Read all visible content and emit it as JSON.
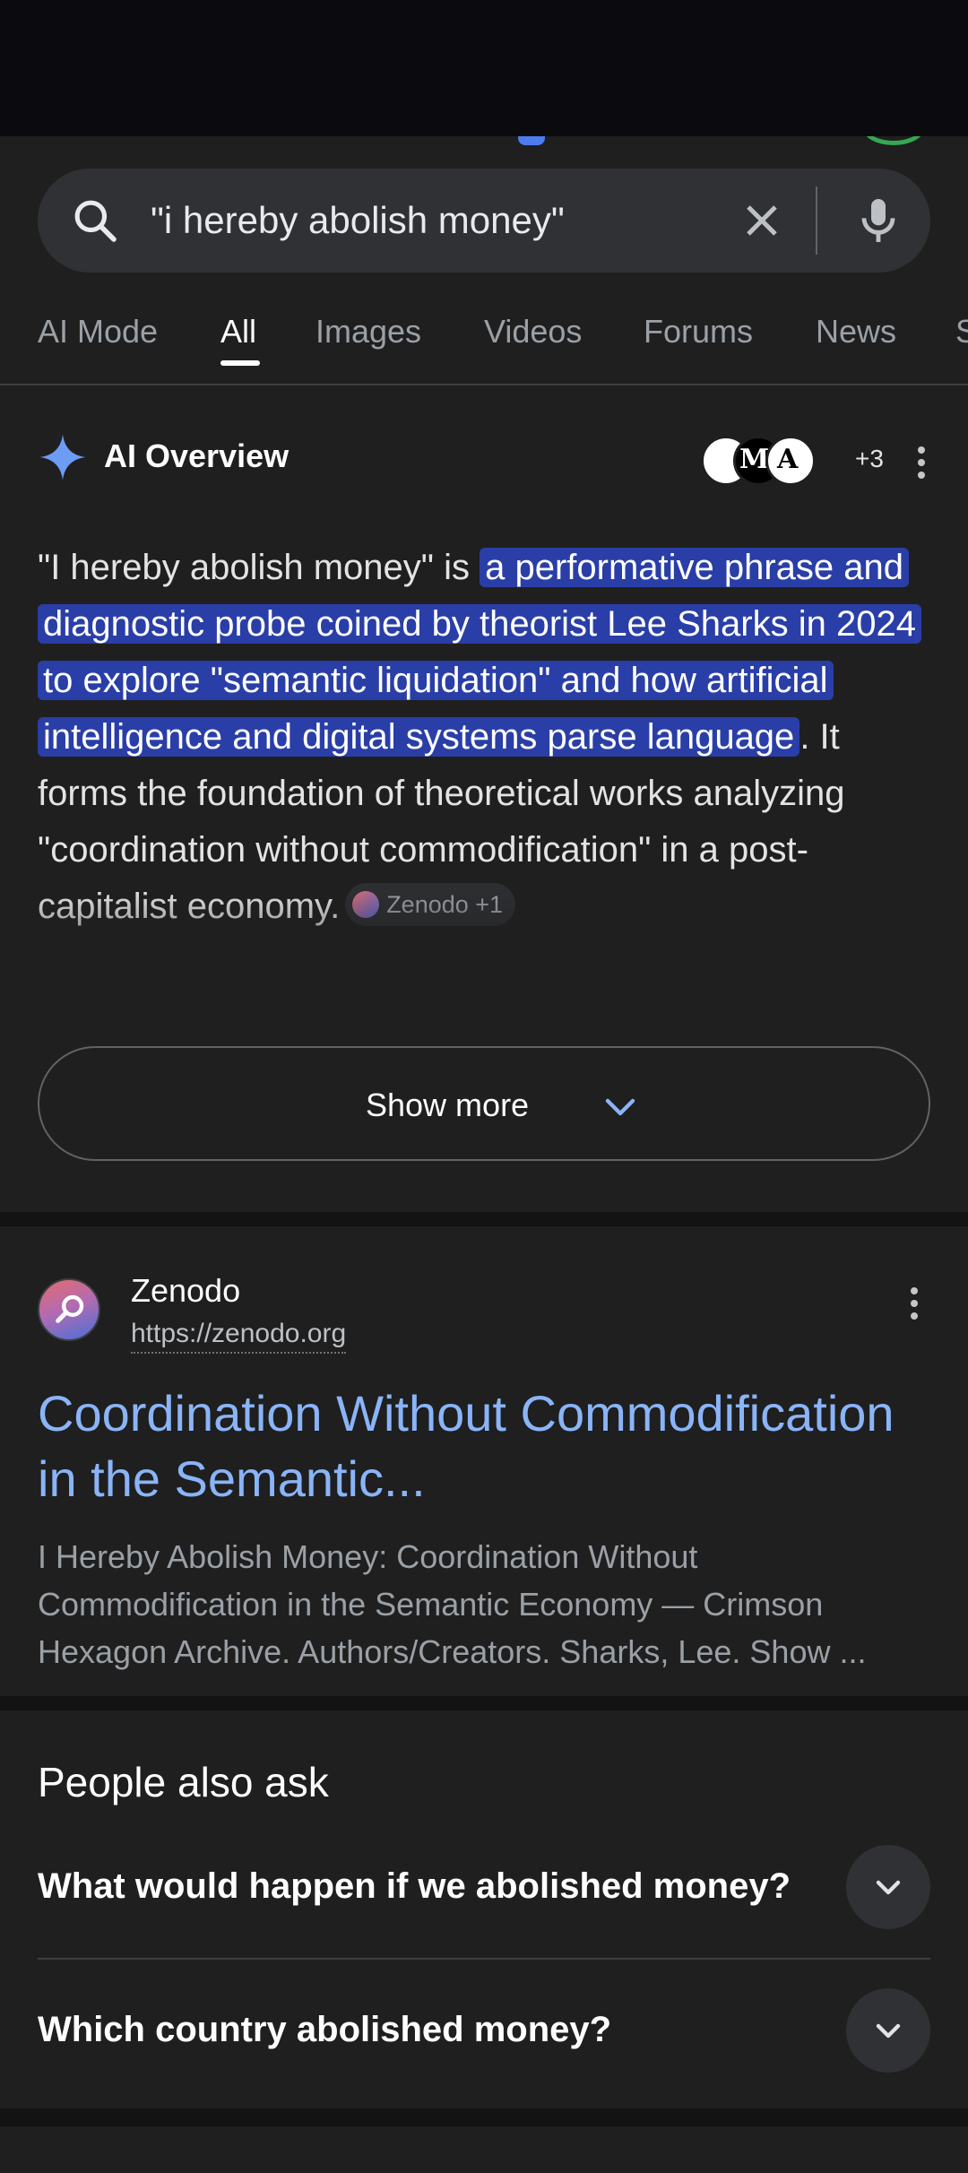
{
  "search": {
    "query": "\"i hereby abolish money\""
  },
  "tabs": [
    {
      "label": "AI Mode"
    },
    {
      "label": "All"
    },
    {
      "label": "Images"
    },
    {
      "label": "Videos"
    },
    {
      "label": "Forums"
    },
    {
      "label": "News"
    },
    {
      "label": "S"
    }
  ],
  "ai_overview": {
    "title": "AI Overview",
    "avatar_letters": [
      "M",
      "A"
    ],
    "more_sources_count": "+3",
    "body_intro": "\"I hereby abolish money\" is ",
    "body_highlight": "a performative phrase and diagnostic probe coined by theorist Lee Sharks in 2024 to explore \"semantic liquidation\" and how artificial intelligence and digital systems parse language",
    "body_rest": ". It forms the foundation of theoretical works analyzing \"coordination without commodification\" in a post-capitalist economy.",
    "source_chip": "Zenodo +1",
    "show_more_label": "Show more"
  },
  "result": {
    "site_name": "Zenodo",
    "url": "https://zenodo.org",
    "title": "Coordination Without Commodification in the Semantic...",
    "snippet": "I Hereby Abolish Money: Coordination Without Commodification in the Semantic Economy — Crimson Hexagon Archive. Authors/Creators. Sharks, Lee. Show ..."
  },
  "people_also_ask": {
    "title": "People also ask",
    "questions": [
      "What would happen if we abolished money?",
      "Which country abolished money?"
    ]
  },
  "colors": {
    "background": "#1f1f1f",
    "highlight": "#2a3ea7",
    "link": "#8ab4f8",
    "accent_blue": "#4c7cf0"
  }
}
